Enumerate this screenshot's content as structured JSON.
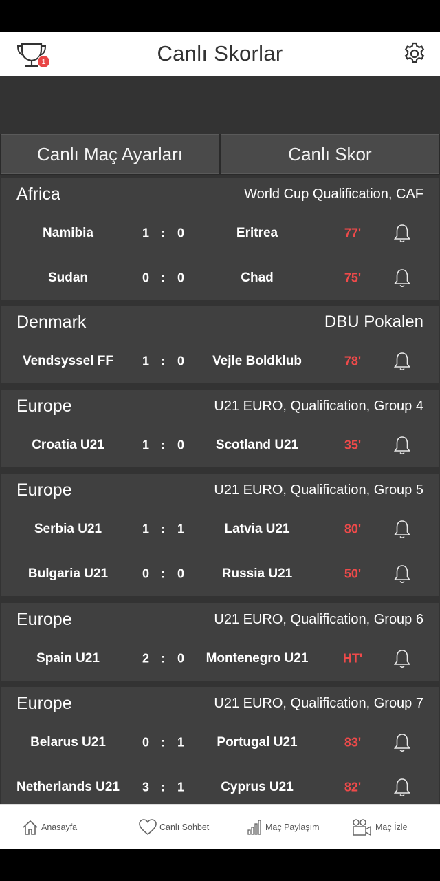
{
  "header": {
    "title": "Canlı Skorlar",
    "badge": "1"
  },
  "tabs": [
    {
      "label": "Canlı Maç Ayarları"
    },
    {
      "label": "Canlı Skor"
    }
  ],
  "groups": [
    {
      "region": "Africa",
      "league": "World Cup Qualification, CAF",
      "matches": [
        {
          "home": "Namibia",
          "home_score": "1",
          "away_score": "0",
          "away": "Eritrea",
          "minute": "77'"
        },
        {
          "home": "Sudan",
          "home_score": "0",
          "away_score": "0",
          "away": "Chad",
          "minute": "75'"
        }
      ]
    },
    {
      "region": "Denmark",
      "league": "DBU Pokalen",
      "matches": [
        {
          "home": "Vendsyssel FF",
          "home_score": "1",
          "away_score": "0",
          "away": "Vejle Boldklub",
          "minute": "78'"
        }
      ]
    },
    {
      "region": "Europe",
      "league": "U21 EURO, Qualification, Group 4",
      "matches": [
        {
          "home": "Croatia U21",
          "home_score": "1",
          "away_score": "0",
          "away": "Scotland U21",
          "minute": "35'"
        }
      ]
    },
    {
      "region": "Europe",
      "league": "U21 EURO, Qualification, Group 5",
      "matches": [
        {
          "home": "Serbia U21",
          "home_score": "1",
          "away_score": "1",
          "away": "Latvia U21",
          "minute": "80'"
        },
        {
          "home": "Bulgaria U21",
          "home_score": "0",
          "away_score": "0",
          "away": "Russia U21",
          "minute": "50'"
        }
      ]
    },
    {
      "region": "Europe",
      "league": "U21 EURO, Qualification, Group 6",
      "matches": [
        {
          "home": "Spain U21",
          "home_score": "2",
          "away_score": "0",
          "away": "Montenegro U21",
          "minute": "HT'"
        }
      ]
    },
    {
      "region": "Europe",
      "league": "U21 EURO, Qualification, Group 7",
      "matches": [
        {
          "home": "Belarus U21",
          "home_score": "0",
          "away_score": "1",
          "away": "Portugal U21",
          "minute": "83'"
        },
        {
          "home": "Netherlands U21",
          "home_score": "3",
          "away_score": "1",
          "away": "Cyprus U21",
          "minute": "82'"
        }
      ]
    }
  ],
  "score_separator": ":",
  "bottom_nav": [
    {
      "label": "Anasayfa",
      "icon": "home-icon"
    },
    {
      "label": "Canlı Sohbet",
      "icon": "heart-icon"
    },
    {
      "label": "Maç Paylaşım",
      "icon": "signal-bars-icon"
    },
    {
      "label": "Maç İzle",
      "icon": "video-camera-icon"
    }
  ]
}
